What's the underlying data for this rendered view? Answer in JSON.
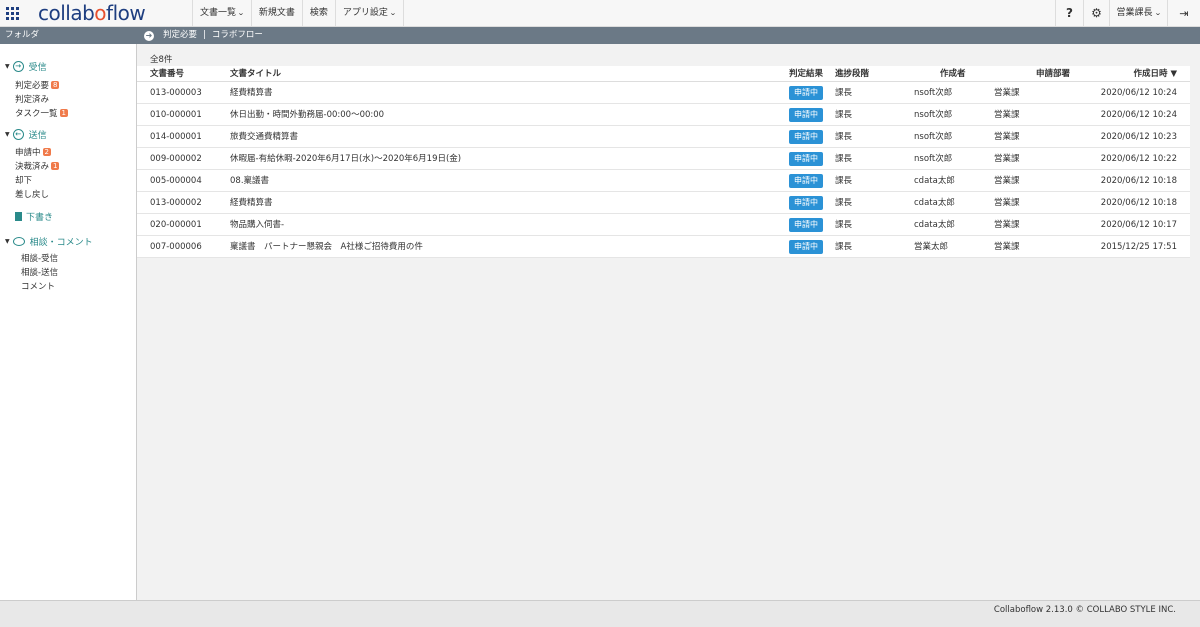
{
  "app": {
    "logo_text": "collaboflow"
  },
  "topnav": {
    "items": [
      {
        "label": "文書一覧",
        "has_dropdown": true
      },
      {
        "label": "新規文書",
        "has_dropdown": false
      },
      {
        "label": "検索",
        "has_dropdown": false
      },
      {
        "label": "アプリ設定",
        "has_dropdown": true
      }
    ],
    "help_label": "?",
    "user_label": "営業課長"
  },
  "subbar": {
    "folder_title": "フォルダ",
    "breadcrumb": [
      "判定必要",
      "コラボフロー"
    ],
    "separator": "|"
  },
  "sidebar": {
    "sections": [
      {
        "label": "受信",
        "icon": "arrow-right-circle-icon",
        "items": [
          {
            "label": "判定必要",
            "badge": "8"
          },
          {
            "label": "判定済み",
            "badge": ""
          },
          {
            "label": "タスク一覧",
            "badge": "1"
          }
        ]
      },
      {
        "label": "送信",
        "icon": "arrow-left-circle-icon",
        "items": [
          {
            "label": "申請中",
            "badge": "2"
          },
          {
            "label": "決裁済み",
            "badge": "1"
          },
          {
            "label": "却下",
            "badge": ""
          },
          {
            "label": "差し戻し",
            "badge": ""
          }
        ]
      },
      {
        "label": "下書き",
        "icon": "document-icon",
        "items": []
      },
      {
        "label": "相談・コメント",
        "icon": "speech-bubble-icon",
        "items": [
          {
            "label": "相談-受信",
            "badge": ""
          },
          {
            "label": "相談-送信",
            "badge": ""
          },
          {
            "label": "コメント",
            "badge": ""
          }
        ]
      }
    ]
  },
  "main": {
    "count": "全8件",
    "columns": {
      "no": "文書番号",
      "title": "文書タイトル",
      "result": "判定結果",
      "step": "進捗段階",
      "author": "作成者",
      "dept": "申請部署",
      "date": "作成日時 ▼"
    },
    "rows": [
      {
        "no": "013-000003",
        "title": "経費精算書",
        "status": "申請中",
        "step": "課長",
        "author": "nsoft次郎",
        "dept": "営業課",
        "date": "2020/06/12 10:24"
      },
      {
        "no": "010-000001",
        "title": "休日出勤・時間外勤務届-00:00〜00:00",
        "status": "申請中",
        "step": "課長",
        "author": "nsoft次郎",
        "dept": "営業課",
        "date": "2020/06/12 10:24"
      },
      {
        "no": "014-000001",
        "title": "旅費交通費精算書",
        "status": "申請中",
        "step": "課長",
        "author": "nsoft次郎",
        "dept": "営業課",
        "date": "2020/06/12 10:23"
      },
      {
        "no": "009-000002",
        "title": "休暇届-有給休暇-2020年6月17日(水)〜2020年6月19日(金)",
        "status": "申請中",
        "step": "課長",
        "author": "nsoft次郎",
        "dept": "営業課",
        "date": "2020/06/12 10:22"
      },
      {
        "no": "005-000004",
        "title": "08.稟議書",
        "status": "申請中",
        "step": "課長",
        "author": "cdata太郎",
        "dept": "営業課",
        "date": "2020/06/12 10:18"
      },
      {
        "no": "013-000002",
        "title": "経費精算書",
        "status": "申請中",
        "step": "課長",
        "author": "cdata太郎",
        "dept": "営業課",
        "date": "2020/06/12 10:18"
      },
      {
        "no": "020-000001",
        "title": "物品購入伺書-",
        "status": "申請中",
        "step": "課長",
        "author": "cdata太郎",
        "dept": "営業課",
        "date": "2020/06/12 10:17"
      },
      {
        "no": "007-000006",
        "title": "稟議書　パートナー懇親会　A社様ご招待費用の件",
        "status": "申請中",
        "step": "課長",
        "author": "営業太郎",
        "dept": "営業課",
        "date": "2015/12/25 17:51"
      }
    ]
  },
  "footer": {
    "text": "Collaboflow 2.13.0 © COLLABO STYLE INC."
  },
  "colors": {
    "brand": "#1e3e80",
    "accent": "#e8502e",
    "header_bar": "#6b7986",
    "status_blue": "#2b92d6",
    "badge_orange": "#f07a4a",
    "folder_teal": "#2a8a8a"
  }
}
